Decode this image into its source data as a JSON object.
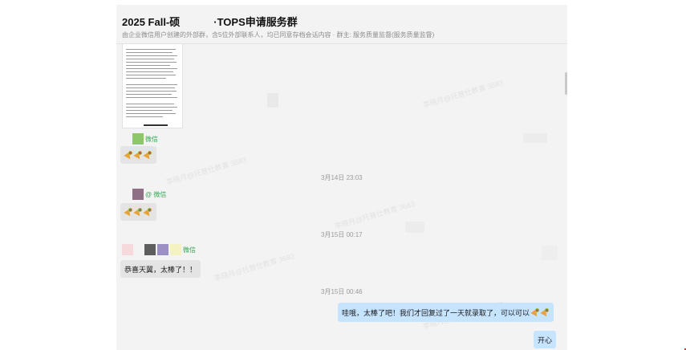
{
  "header": {
    "title_prefix": "2025 Fall-硕",
    "title_suffix": "·TOPS申请服务群",
    "subtitle": "由企业微信用户创建的外部群，含5位外部联系人，均已同意存档会话内容 · 群主: 服务质量监督(服务质量监督)"
  },
  "messages": {
    "m1_sender_suffix": "微信",
    "m2_time": "3月14日 23:03",
    "m2_sender_suffix": "@ 微信",
    "m3_time": "3月15日 00:17",
    "m3_sender_suffix": "微信",
    "m3_text": "恭喜天翼，太棒了！！",
    "m4_time": "3月15日 00:46",
    "m4_text": "哇哦，太棒了吧！我们才回复过了一天就录取了，可以可以",
    "m5_text": "开心"
  },
  "watermark": "李晓月@托普仕教育 3683",
  "colors": {
    "my_bubble": "#c7e4ff",
    "sender_name": "#3aa556"
  }
}
